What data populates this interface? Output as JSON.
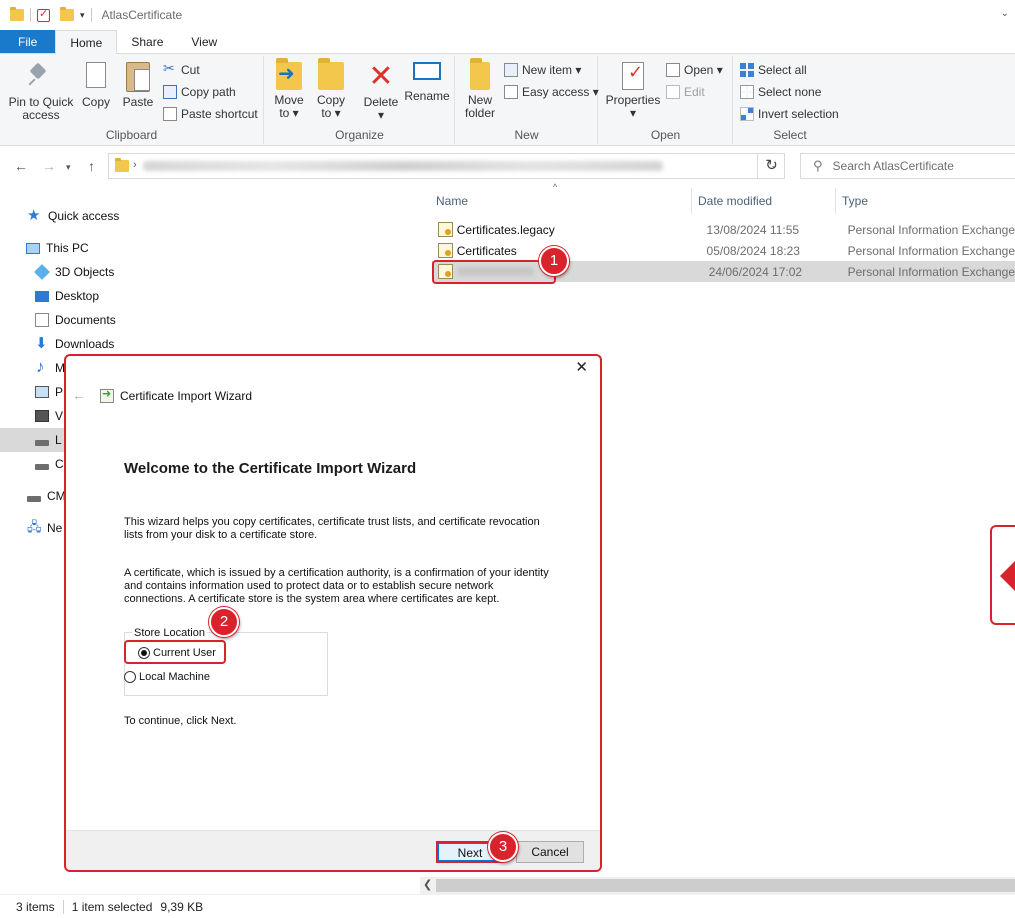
{
  "window": {
    "title": "AtlasCertificate"
  },
  "ribbon_tabs": [
    "File",
    "Home",
    "Share",
    "View"
  ],
  "ribbon": {
    "clipboard": {
      "label": "Clipboard",
      "pin_label_1": "Pin to Quick",
      "pin_label_2": "access",
      "copy": "Copy",
      "paste": "Paste",
      "cut": "Cut",
      "copy_path": "Copy path",
      "paste_shortcut": "Paste shortcut"
    },
    "organize": {
      "label": "Organize",
      "move_to_1": "Move",
      "move_to_2": "to ▾",
      "copy_to_1": "Copy",
      "copy_to_2": "to ▾",
      "delete_1": "Delete",
      "delete_2": "▾",
      "rename": "Rename"
    },
    "new": {
      "label": "New",
      "new_folder_1": "New",
      "new_folder_2": "folder",
      "new_item": "New item ▾",
      "easy_access": "Easy access ▾"
    },
    "open": {
      "label": "Open",
      "properties_1": "Properties",
      "properties_2": "▾",
      "open": "Open ▾",
      "edit": "Edit"
    },
    "select": {
      "label": "Select",
      "select_all": "Select all",
      "select_none": "Select none",
      "invert_selection": "Invert selection"
    }
  },
  "search": {
    "placeholder": "Search AtlasCertificate"
  },
  "nav_pane": {
    "quick_access": "Quick access",
    "this_pc": "This PC",
    "items": [
      "3D Objects",
      "Desktop",
      "Documents",
      "Downloads",
      "M",
      "P",
      "V",
      "L",
      "C"
    ],
    "cm": "CM",
    "network": "Ne"
  },
  "file_list": {
    "columns": [
      "Name",
      "Date modified",
      "Type"
    ],
    "rows": [
      {
        "name": "Certificates.legacy",
        "date": "13/08/2024 11:55",
        "type": "Personal Information Exchange"
      },
      {
        "name": "Certificates",
        "date": "05/08/2024 18:23",
        "type": "Personal Information Exchange"
      },
      {
        "name": "",
        "date": "24/06/2024 17:02",
        "type": "Personal Information Exchange"
      }
    ]
  },
  "annotations": {
    "badge1": "1",
    "badge2": "2",
    "badge3": "3"
  },
  "dialog": {
    "close": "✕",
    "title": "Certificate Import Wizard",
    "heading": "Welcome to the Certificate Import Wizard",
    "para1_line1": "This wizard helps you copy certificates, certificate trust lists, and certificate revocation",
    "para1_line2": "lists from your disk to a certificate store.",
    "para2_line1": "A certificate, which is issued by a certification authority, is a confirmation of your identity",
    "para2_line2": "and contains information used to protect data or to establish secure network",
    "para2_line3": "connections. A certificate store is the system area where certificates are kept.",
    "store_location": "Store Location",
    "current_user": "Current User",
    "local_machine": "Local Machine",
    "continue_text": "To continue, click Next.",
    "next": "Next",
    "cancel": "Cancel"
  },
  "statusbar": {
    "items_count": "3 items",
    "selected": "1 item selected",
    "size": "9,39 KB"
  },
  "colors": {
    "accent": "#1979ca",
    "annotation": "#d9232c"
  }
}
